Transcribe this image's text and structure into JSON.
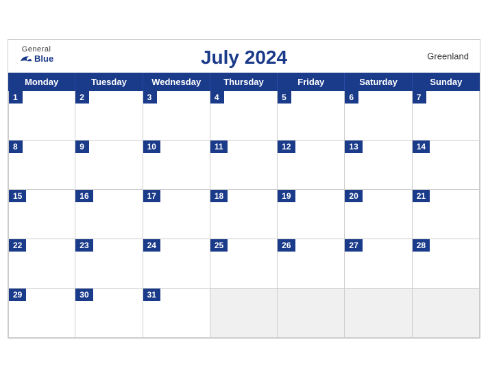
{
  "calendar": {
    "title": "July 2024",
    "region": "Greenland",
    "logo": {
      "general": "General",
      "blue": "Blue"
    },
    "dayHeaders": [
      "Monday",
      "Tuesday",
      "Wednesday",
      "Thursday",
      "Friday",
      "Saturday",
      "Sunday"
    ],
    "weeks": [
      [
        {
          "day": 1,
          "empty": false
        },
        {
          "day": 2,
          "empty": false
        },
        {
          "day": 3,
          "empty": false
        },
        {
          "day": 4,
          "empty": false
        },
        {
          "day": 5,
          "empty": false
        },
        {
          "day": 6,
          "empty": false
        },
        {
          "day": 7,
          "empty": false
        }
      ],
      [
        {
          "day": 8,
          "empty": false
        },
        {
          "day": 9,
          "empty": false
        },
        {
          "day": 10,
          "empty": false
        },
        {
          "day": 11,
          "empty": false
        },
        {
          "day": 12,
          "empty": false
        },
        {
          "day": 13,
          "empty": false
        },
        {
          "day": 14,
          "empty": false
        }
      ],
      [
        {
          "day": 15,
          "empty": false
        },
        {
          "day": 16,
          "empty": false
        },
        {
          "day": 17,
          "empty": false
        },
        {
          "day": 18,
          "empty": false
        },
        {
          "day": 19,
          "empty": false
        },
        {
          "day": 20,
          "empty": false
        },
        {
          "day": 21,
          "empty": false
        }
      ],
      [
        {
          "day": 22,
          "empty": false
        },
        {
          "day": 23,
          "empty": false
        },
        {
          "day": 24,
          "empty": false
        },
        {
          "day": 25,
          "empty": false
        },
        {
          "day": 26,
          "empty": false
        },
        {
          "day": 27,
          "empty": false
        },
        {
          "day": 28,
          "empty": false
        }
      ],
      [
        {
          "day": 29,
          "empty": false
        },
        {
          "day": 30,
          "empty": false
        },
        {
          "day": 31,
          "empty": false
        },
        {
          "day": null,
          "empty": true
        },
        {
          "day": null,
          "empty": true
        },
        {
          "day": null,
          "empty": true
        },
        {
          "day": null,
          "empty": true
        }
      ]
    ]
  }
}
